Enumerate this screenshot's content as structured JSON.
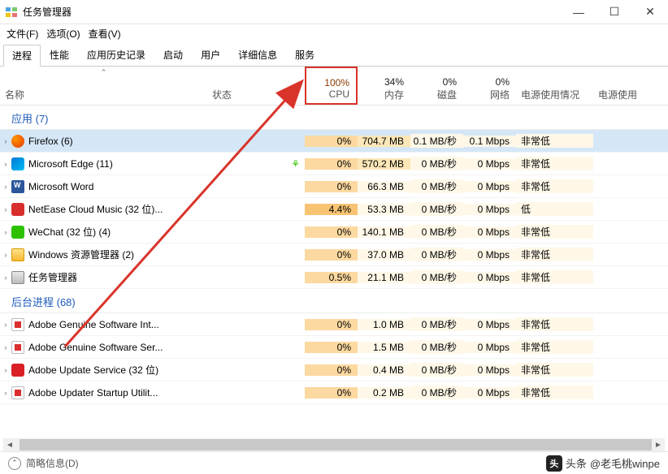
{
  "window": {
    "title": "任务管理器"
  },
  "menu": {
    "file": "文件(F)",
    "options": "选项(O)",
    "view": "查看(V)"
  },
  "tabs": [
    "进程",
    "性能",
    "应用历史记录",
    "启动",
    "用户",
    "详细信息",
    "服务"
  ],
  "headers": {
    "name": "名称",
    "status": "状态",
    "cpu": {
      "pct": "100%",
      "label": "CPU"
    },
    "mem": {
      "pct": "34%",
      "label": "内存"
    },
    "disk": {
      "pct": "0%",
      "label": "磁盘"
    },
    "net": {
      "pct": "0%",
      "label": "网络"
    },
    "power": "电源使用情况",
    "power2": "电源使用"
  },
  "groups": {
    "apps": "应用 (7)",
    "bg": "后台进程 (68)"
  },
  "rows": [
    {
      "i": "firefox",
      "n": "Firefox (6)",
      "cpu": "0%",
      "mem": "704.7 MB",
      "disk": "0.1 MB/秒",
      "net": "0.1 Mbps",
      "pw": "非常低",
      "sel": true
    },
    {
      "i": "edge",
      "n": "Microsoft Edge (11)",
      "cpu": "0%",
      "mem": "570.2 MB",
      "disk": "0 MB/秒",
      "net": "0 Mbps",
      "pw": "非常低",
      "leaf": true
    },
    {
      "i": "word",
      "n": "Microsoft Word",
      "cpu": "0%",
      "mem": "66.3 MB",
      "disk": "0 MB/秒",
      "net": "0 Mbps",
      "pw": "非常低"
    },
    {
      "i": "netease",
      "n": "NetEase Cloud Music (32 位)...",
      "cpu": "4.4%",
      "mem": "53.3 MB",
      "disk": "0 MB/秒",
      "net": "0 Mbps",
      "pw": "低",
      "hot": true
    },
    {
      "i": "wechat",
      "n": "WeChat (32 位) (4)",
      "cpu": "0%",
      "mem": "140.1 MB",
      "disk": "0 MB/秒",
      "net": "0 Mbps",
      "pw": "非常低"
    },
    {
      "i": "explorer",
      "n": "Windows 资源管理器 (2)",
      "cpu": "0%",
      "mem": "37.0 MB",
      "disk": "0 MB/秒",
      "net": "0 Mbps",
      "pw": "非常低"
    },
    {
      "i": "taskmgr",
      "n": "任务管理器",
      "cpu": "0.5%",
      "mem": "21.1 MB",
      "disk": "0 MB/秒",
      "net": "0 Mbps",
      "pw": "非常低"
    }
  ],
  "bgrows": [
    {
      "i": "adobe",
      "n": "Adobe Genuine Software Int...",
      "cpu": "0%",
      "mem": "1.0 MB",
      "disk": "0 MB/秒",
      "net": "0 Mbps",
      "pw": "非常低"
    },
    {
      "i": "adobe",
      "n": "Adobe Genuine Software Ser...",
      "cpu": "0%",
      "mem": "1.5 MB",
      "disk": "0 MB/秒",
      "net": "0 Mbps",
      "pw": "非常低"
    },
    {
      "i": "adobered",
      "n": "Adobe Update Service (32 位)",
      "cpu": "0%",
      "mem": "0.4 MB",
      "disk": "0 MB/秒",
      "net": "0 Mbps",
      "pw": "非常低"
    },
    {
      "i": "adobe",
      "n": "Adobe Updater Startup Utilit...",
      "cpu": "0%",
      "mem": "0.2 MB",
      "disk": "0 MB/秒",
      "net": "0 Mbps",
      "pw": "非常低"
    }
  ],
  "footer": {
    "brief": "简略信息(D)",
    "attribution_prefix": "头条",
    "attribution": "@老毛桃winpe"
  }
}
